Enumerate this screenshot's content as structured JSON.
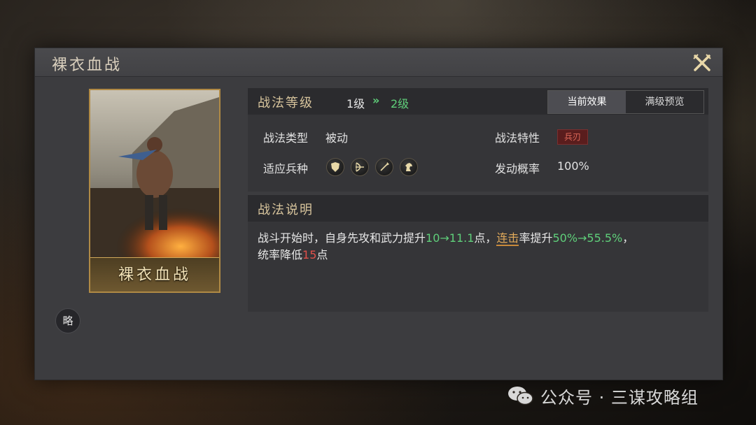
{
  "dialog": {
    "title": "裸衣血战",
    "close_icon": "crossed-swords-close-icon"
  },
  "card": {
    "label": "裸衣血战",
    "art": "warrior-battle-illustration"
  },
  "brief_button": {
    "label": "略"
  },
  "level": {
    "label": "战法等级",
    "current": "1级",
    "arrow": "»",
    "next": "2级"
  },
  "tabs": [
    {
      "label": "当前效果",
      "active": true
    },
    {
      "label": "满级预览",
      "active": false
    }
  ],
  "fields": {
    "type_label": "战法类型",
    "type_value": "被动",
    "trait_label": "战法特性",
    "trait_value": "兵刃",
    "troops_label": "适应兵种",
    "troops_icons": [
      "shield-icon",
      "bow-icon",
      "spear-icon",
      "horse-icon"
    ],
    "chance_label": "发动概率",
    "chance_value": "100%"
  },
  "description": {
    "title": "战法说明",
    "p1": "战斗开始时，自身先攻和武力提升",
    "v1": "10→11.1",
    "p2": "点，",
    "link": "连击",
    "p3": "率提升",
    "v2": "50%→55.5%",
    "p4": "，",
    "p5": "统率降低",
    "v3": "15",
    "p6": "点"
  },
  "watermark": {
    "text": "公众号 · 三谋攻略组",
    "icon": "wechat-icon"
  },
  "colors": {
    "accent_green": "#5fcf7a",
    "accent_red": "#e0504a",
    "gold": "#d7c49c"
  }
}
